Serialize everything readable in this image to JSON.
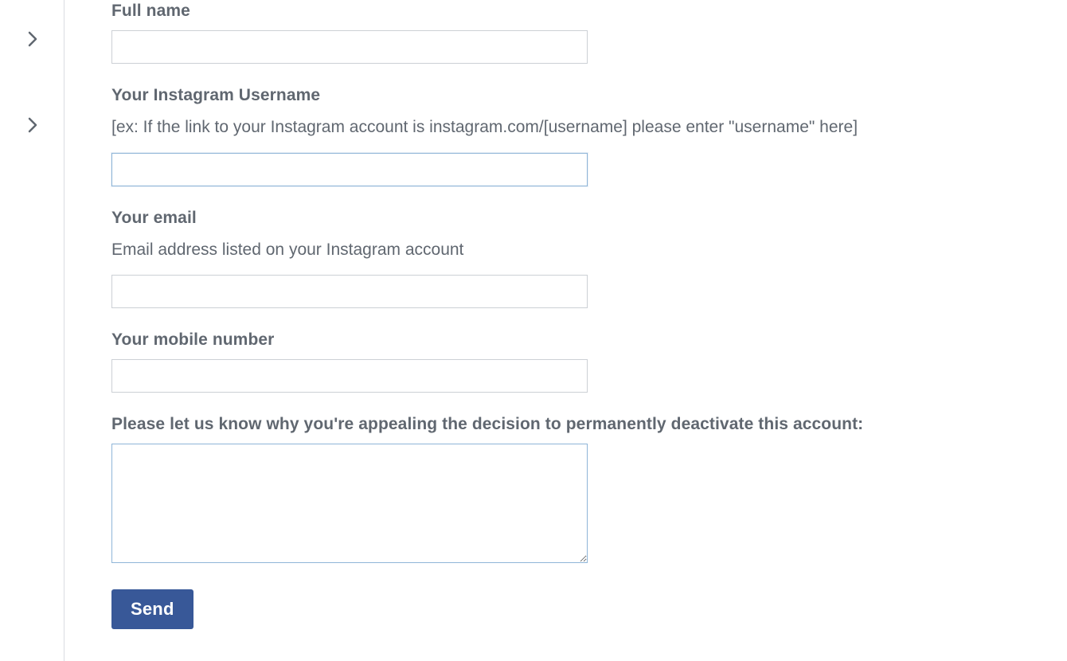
{
  "form": {
    "fullName": {
      "label": "Full name",
      "value": ""
    },
    "username": {
      "label": "Your Instagram Username",
      "hint": "[ex: If the link to your Instagram account is instagram.com/[username] please enter \"username\" here]",
      "value": ""
    },
    "email": {
      "label": "Your email",
      "hint": "Email address listed on your Instagram account",
      "value": ""
    },
    "mobile": {
      "label": "Your mobile number",
      "value": ""
    },
    "reason": {
      "label": "Please let us know why you're appealing the decision to permanently deactivate this account:",
      "value": ""
    },
    "submit": {
      "label": "Send"
    }
  }
}
